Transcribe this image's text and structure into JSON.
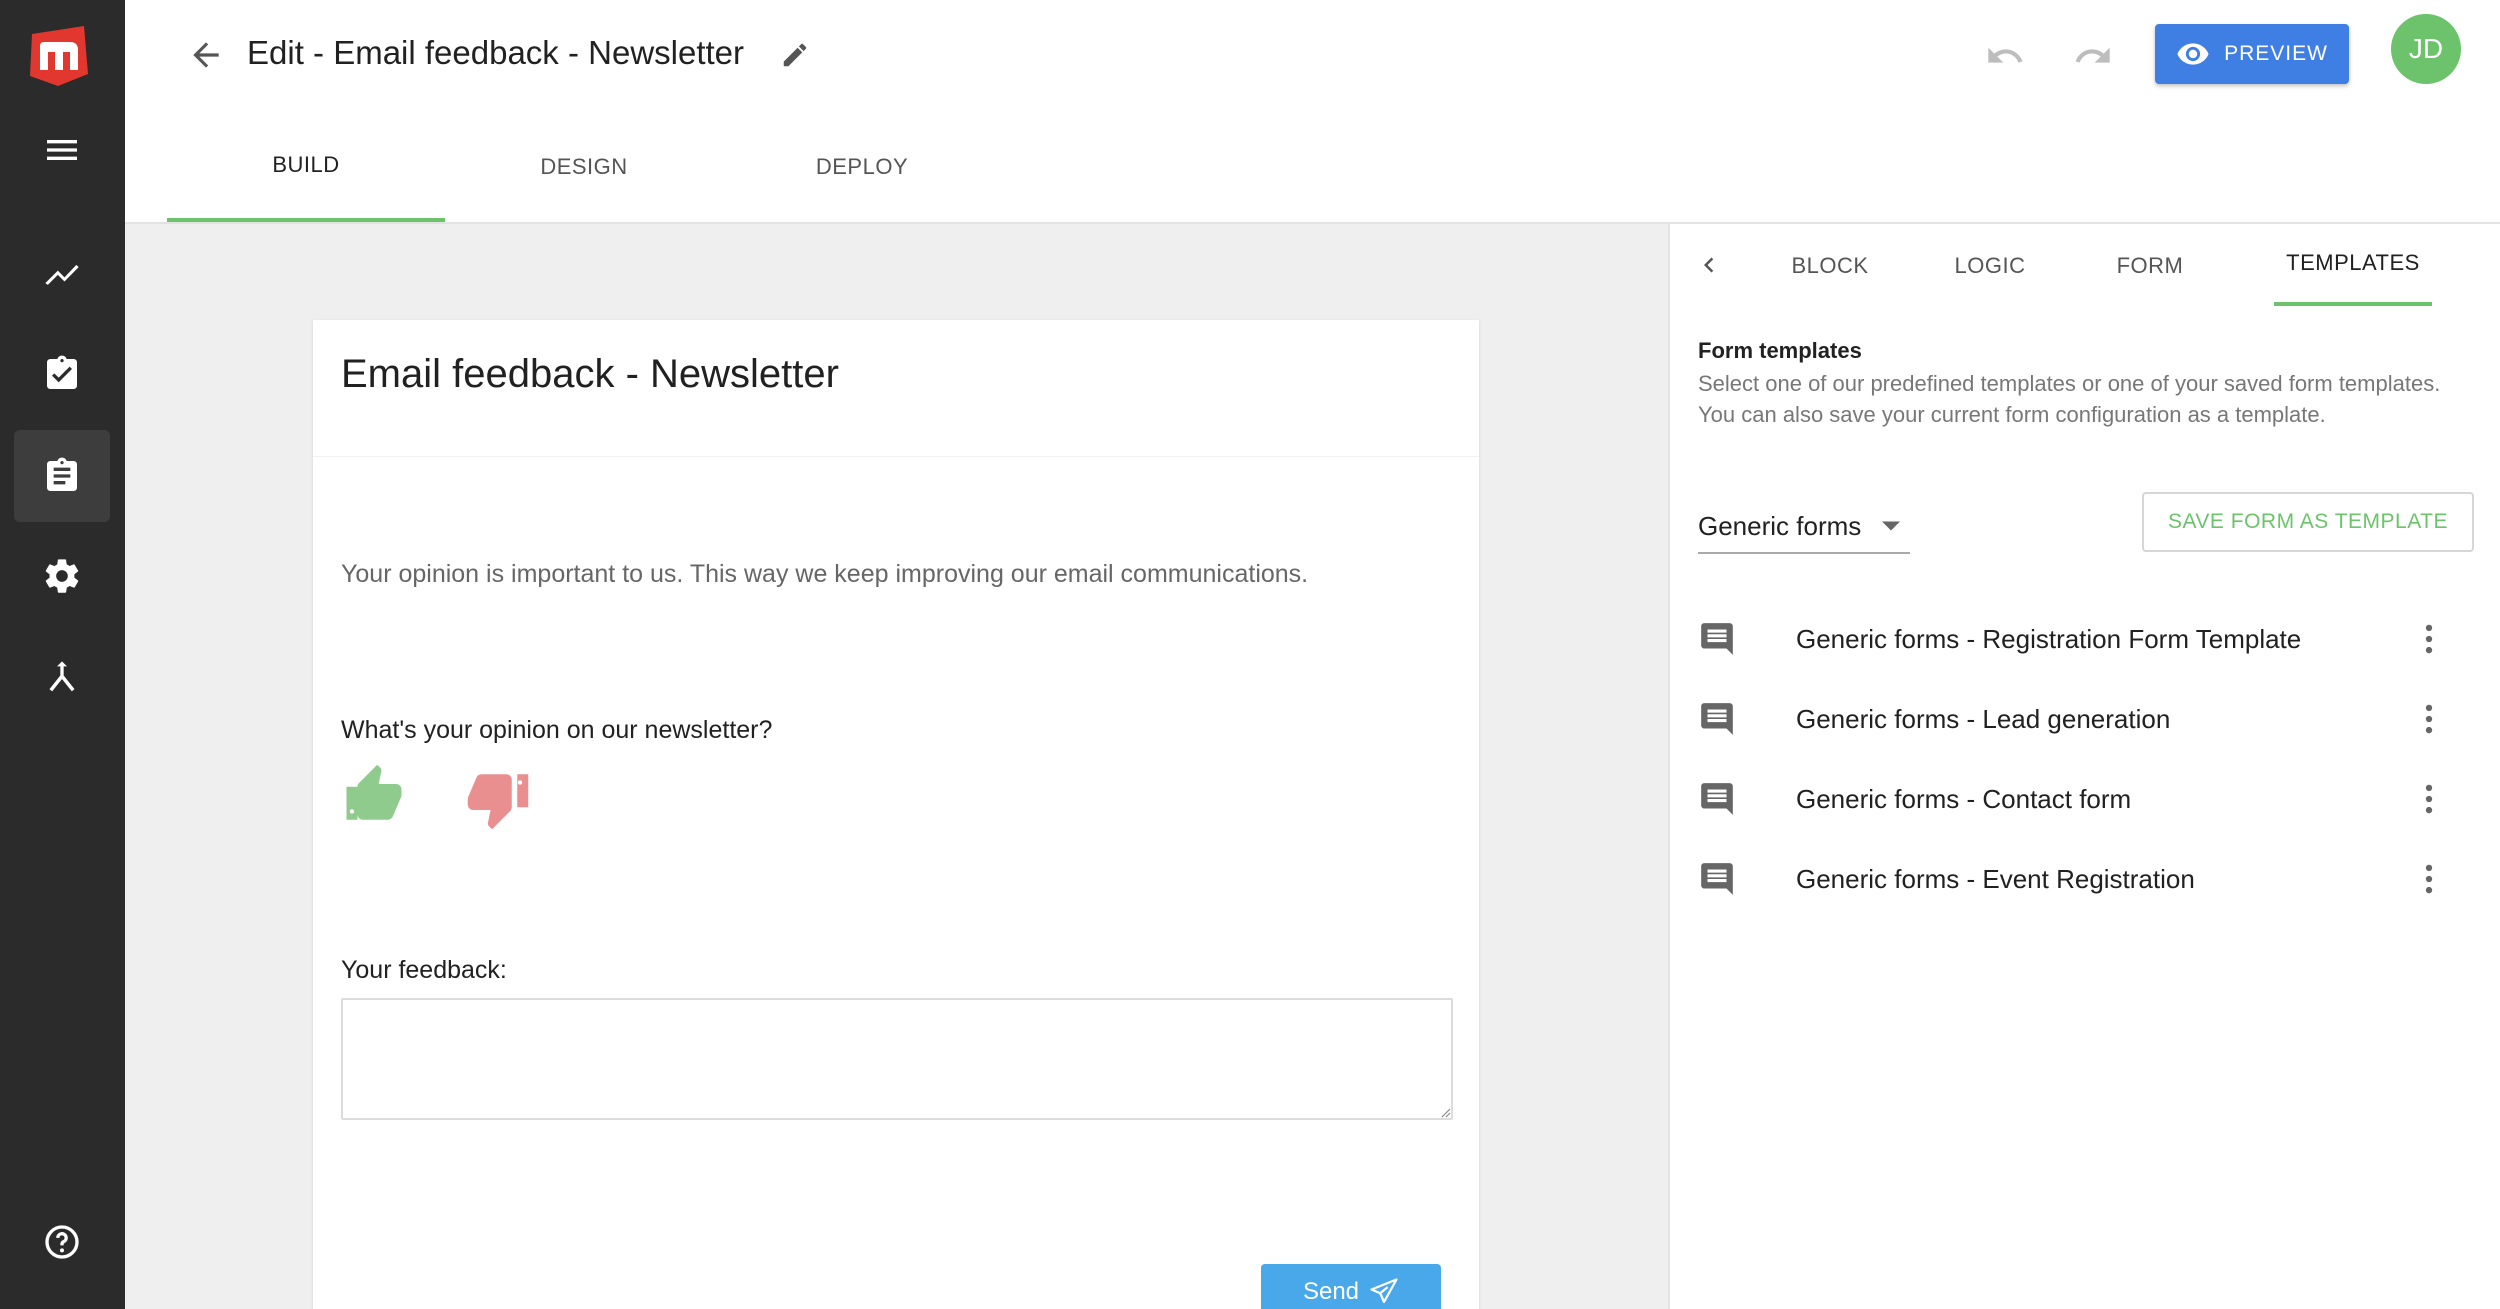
{
  "header": {
    "title": "Edit - Email feedback - Newsletter",
    "preview_label": "PREVIEW",
    "avatar_initials": "JD"
  },
  "main_tabs": [
    {
      "label": "BUILD",
      "active": true
    },
    {
      "label": "DESIGN",
      "active": false
    },
    {
      "label": "DEPLOY",
      "active": false
    }
  ],
  "form": {
    "title": "Email feedback - Newsletter",
    "intro": "Your opinion is important to us. This way we keep improving our email communications.",
    "question": "What's your opinion on our newsletter?",
    "feedback_label": "Your feedback:",
    "feedback_value": "",
    "send_label": "Send"
  },
  "panel": {
    "tabs": [
      {
        "label": "BLOCK",
        "active": false
      },
      {
        "label": "LOGIC",
        "active": false
      },
      {
        "label": "FORM",
        "active": false
      },
      {
        "label": "TEMPLATES",
        "active": true
      }
    ],
    "section_title": "Form templates",
    "section_desc": "Select one of our predefined templates or one of your saved form templates. You can also save your current form configuration as a template.",
    "category_selected": "Generic forms",
    "save_template_label": "SAVE FORM AS TEMPLATE",
    "templates": [
      {
        "label": "Generic forms - Registration Form Template"
      },
      {
        "label": "Generic forms - Lead generation"
      },
      {
        "label": "Generic forms - Contact form"
      },
      {
        "label": "Generic forms - Event Registration"
      }
    ]
  },
  "icons": {
    "logo": "mailup-logo",
    "sidebar": [
      "menu-icon",
      "analytics-icon",
      "tasks-icon",
      "forms-icon",
      "settings-icon",
      "merge-icon",
      "help-icon"
    ]
  },
  "colors": {
    "sidebar_bg": "#2b2b2b",
    "accent_green": "#6cc36b",
    "preview_blue": "#3f7fe3",
    "send_blue": "#49a8ea",
    "thumb_up": "#8fcb8c",
    "thumb_down": "#ea8f8f",
    "logo_red": "#e2372f"
  }
}
